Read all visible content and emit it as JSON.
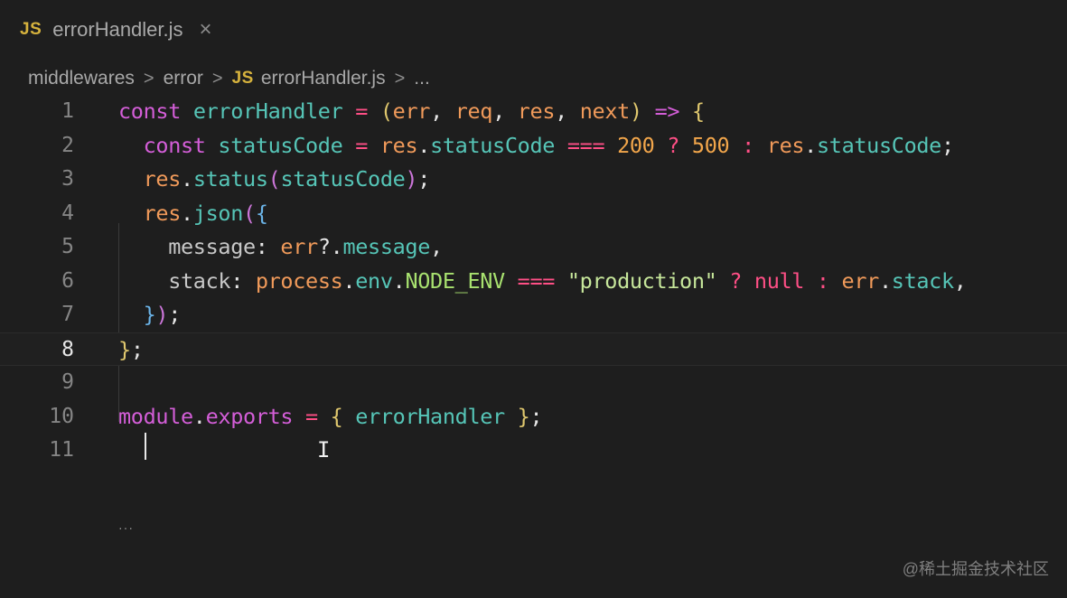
{
  "tab": {
    "file_icon": "JS",
    "label": "errorHandler.js",
    "close_icon": "×"
  },
  "breadcrumb": {
    "items": [
      "middlewares",
      "error",
      "errorHandler.js",
      "..."
    ],
    "separator": ">"
  },
  "editor": {
    "line_numbers": [
      "1",
      "2",
      "3",
      "4",
      "5",
      "6",
      "7",
      "8",
      "9",
      "10",
      "11"
    ],
    "active_line": "8",
    "code_lines": [
      [
        {
          "t": "const",
          "c": "k"
        },
        {
          "t": " ",
          "c": "t"
        },
        {
          "t": "errorHandler",
          "c": "f"
        },
        {
          "t": " ",
          "c": "t"
        },
        {
          "t": "=",
          "c": "o"
        },
        {
          "t": " ",
          "c": "t"
        },
        {
          "t": "(",
          "c": "p"
        },
        {
          "t": "err",
          "c": "v"
        },
        {
          "t": ",",
          "c": "t"
        },
        {
          "t": " ",
          "c": "t"
        },
        {
          "t": "req",
          "c": "v"
        },
        {
          "t": ",",
          "c": "t"
        },
        {
          "t": " ",
          "c": "t"
        },
        {
          "t": "res",
          "c": "v"
        },
        {
          "t": ",",
          "c": "t"
        },
        {
          "t": " ",
          "c": "t"
        },
        {
          "t": "next",
          "c": "v"
        },
        {
          "t": ")",
          "c": "p"
        },
        {
          "t": " ",
          "c": "t"
        },
        {
          "t": "=>",
          "c": "k"
        },
        {
          "t": " ",
          "c": "t"
        },
        {
          "t": "{",
          "c": "p"
        }
      ],
      [
        {
          "t": "  ",
          "c": "t"
        },
        {
          "t": "const",
          "c": "k"
        },
        {
          "t": " ",
          "c": "t"
        },
        {
          "t": "statusCode",
          "c": "f"
        },
        {
          "t": " ",
          "c": "t"
        },
        {
          "t": "=",
          "c": "o"
        },
        {
          "t": " ",
          "c": "t"
        },
        {
          "t": "res",
          "c": "v"
        },
        {
          "t": ".",
          "c": "t"
        },
        {
          "t": "statusCode",
          "c": "f"
        },
        {
          "t": " ",
          "c": "t"
        },
        {
          "t": "===",
          "c": "o"
        },
        {
          "t": " ",
          "c": "t"
        },
        {
          "t": "200",
          "c": "n"
        },
        {
          "t": " ",
          "c": "t"
        },
        {
          "t": "?",
          "c": "o"
        },
        {
          "t": " ",
          "c": "t"
        },
        {
          "t": "500",
          "c": "n"
        },
        {
          "t": " ",
          "c": "t"
        },
        {
          "t": ":",
          "c": "o"
        },
        {
          "t": " ",
          "c": "t"
        },
        {
          "t": "res",
          "c": "v"
        },
        {
          "t": ".",
          "c": "t"
        },
        {
          "t": "statusCode",
          "c": "f"
        },
        {
          "t": ";",
          "c": "t"
        }
      ],
      [
        {
          "t": "  ",
          "c": "t"
        },
        {
          "t": "res",
          "c": "v"
        },
        {
          "t": ".",
          "c": "t"
        },
        {
          "t": "status",
          "c": "f"
        },
        {
          "t": "(",
          "c": "pp"
        },
        {
          "t": "statusCode",
          "c": "f"
        },
        {
          "t": ")",
          "c": "pp"
        },
        {
          "t": ";",
          "c": "t"
        }
      ],
      [
        {
          "t": "  ",
          "c": "t"
        },
        {
          "t": "res",
          "c": "v"
        },
        {
          "t": ".",
          "c": "t"
        },
        {
          "t": "json",
          "c": "f"
        },
        {
          "t": "(",
          "c": "pp"
        },
        {
          "t": "{",
          "c": "pb"
        }
      ],
      [
        {
          "t": "    ",
          "c": "t"
        },
        {
          "t": "message",
          "c": "d"
        },
        {
          "t": ":",
          "c": "t"
        },
        {
          "t": " ",
          "c": "t"
        },
        {
          "t": "err",
          "c": "v"
        },
        {
          "t": "?.",
          "c": "t"
        },
        {
          "t": "message",
          "c": "f"
        },
        {
          "t": ",",
          "c": "t"
        }
      ],
      [
        {
          "t": "    ",
          "c": "t"
        },
        {
          "t": "stack",
          "c": "d"
        },
        {
          "t": ":",
          "c": "t"
        },
        {
          "t": " ",
          "c": "t"
        },
        {
          "t": "process",
          "c": "v"
        },
        {
          "t": ".",
          "c": "t"
        },
        {
          "t": "env",
          "c": "f"
        },
        {
          "t": ".",
          "c": "t"
        },
        {
          "t": "NODE_ENV",
          "c": "m"
        },
        {
          "t": " ",
          "c": "t"
        },
        {
          "t": "===",
          "c": "o"
        },
        {
          "t": " ",
          "c": "t"
        },
        {
          "t": "\"production\"",
          "c": "s"
        },
        {
          "t": " ",
          "c": "t"
        },
        {
          "t": "?",
          "c": "o"
        },
        {
          "t": " ",
          "c": "t"
        },
        {
          "t": "null",
          "c": "o"
        },
        {
          "t": " ",
          "c": "t"
        },
        {
          "t": ":",
          "c": "o"
        },
        {
          "t": " ",
          "c": "t"
        },
        {
          "t": "err",
          "c": "v"
        },
        {
          "t": ".",
          "c": "t"
        },
        {
          "t": "stack",
          "c": "f"
        },
        {
          "t": ",",
          "c": "t"
        }
      ],
      [
        {
          "t": "  ",
          "c": "t"
        },
        {
          "t": "}",
          "c": "pb"
        },
        {
          "t": ")",
          "c": "pp"
        },
        {
          "t": ";",
          "c": "t"
        }
      ],
      [
        {
          "t": "}",
          "c": "p"
        },
        {
          "t": ";",
          "c": "t"
        }
      ],
      [],
      [
        {
          "t": "module",
          "c": "k"
        },
        {
          "t": ".",
          "c": "t"
        },
        {
          "t": "exports",
          "c": "k"
        },
        {
          "t": " ",
          "c": "t"
        },
        {
          "t": "=",
          "c": "o"
        },
        {
          "t": " ",
          "c": "t"
        },
        {
          "t": "{",
          "c": "p"
        },
        {
          "t": " ",
          "c": "t"
        },
        {
          "t": "errorHandler",
          "c": "f"
        },
        {
          "t": " ",
          "c": "t"
        },
        {
          "t": "}",
          "c": "p"
        },
        {
          "t": ";",
          "c": "t"
        }
      ],
      []
    ]
  },
  "colors": {
    "background": "#1e1e1e",
    "keyword": "#d45ed8",
    "identifier": "#56c5b7",
    "parameter": "#f09a5a",
    "operator": "#ff4f86",
    "number": "#f2a64b",
    "string": "#c7e79b",
    "bracket_gold": "#e0c86e",
    "bracket_purple": "#cc76da",
    "bracket_blue": "#6bb4e8"
  },
  "icons": {
    "file_type": "javascript-file-icon",
    "close": "close-icon",
    "cursor": "text-cursor-icon"
  },
  "watermark": "@稀土掘金技术社区"
}
